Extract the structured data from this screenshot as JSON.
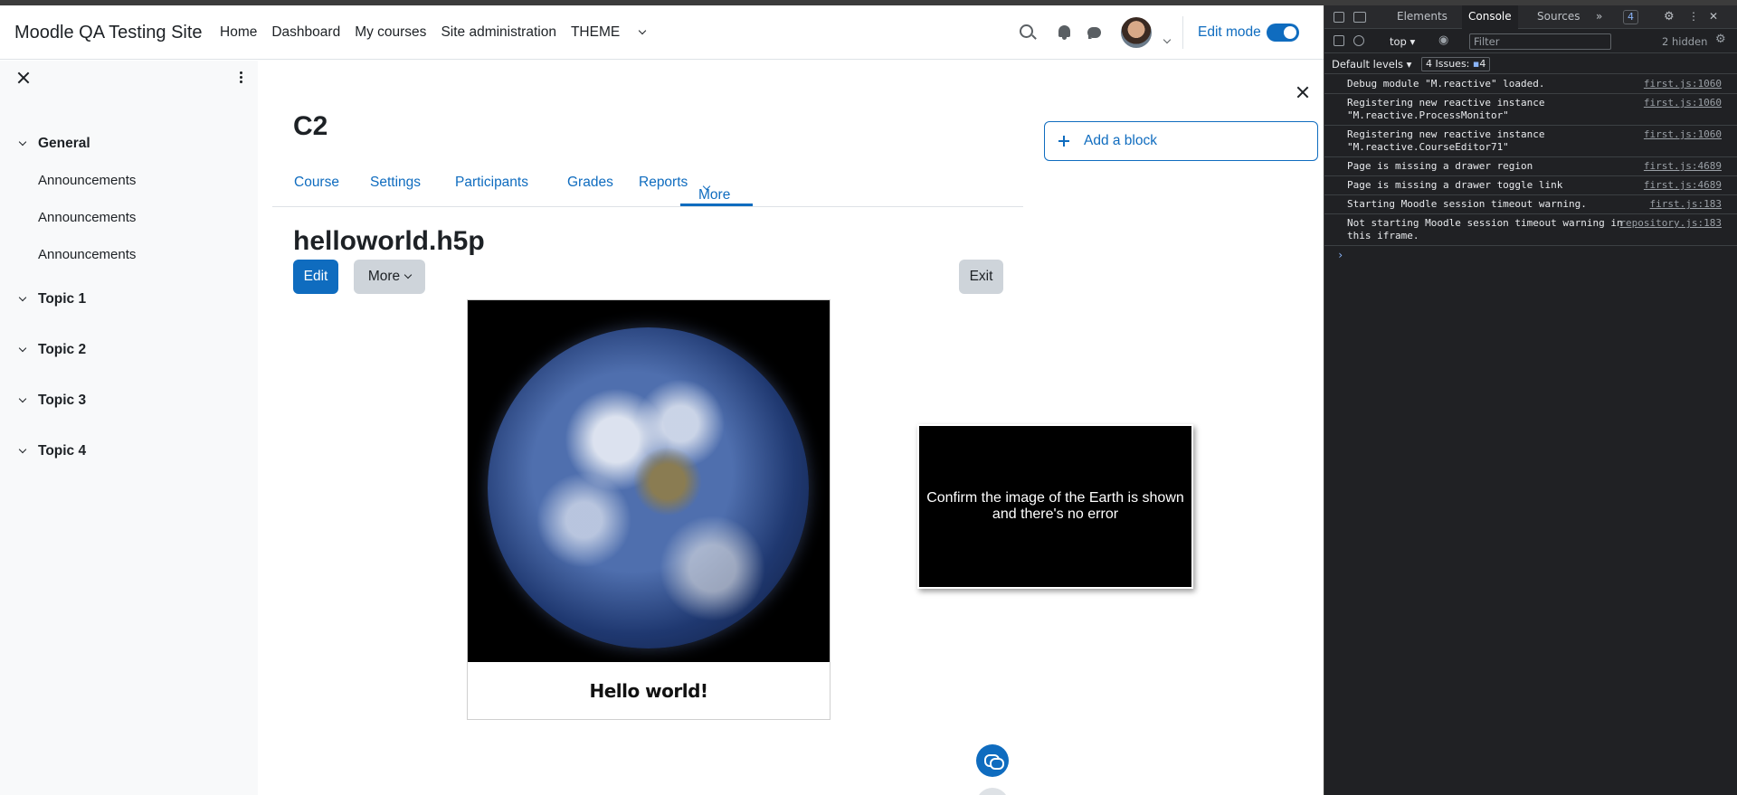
{
  "navbar": {
    "brand": "Moodle QA Testing Site",
    "nav_items": [
      "Home",
      "Dashboard",
      "My courses",
      "Site administration",
      "THEME"
    ],
    "edit_mode_label": "Edit mode"
  },
  "course_index": {
    "sections": [
      {
        "title": "General",
        "items": [
          "Announcements",
          "Announcements",
          "Announcements"
        ]
      },
      {
        "title": "Topic 1"
      },
      {
        "title": "Topic 2"
      },
      {
        "title": "Topic 3"
      },
      {
        "title": "Topic 4"
      }
    ]
  },
  "main": {
    "course_title": "C2",
    "tabs": [
      "Course",
      "Settings",
      "Participants",
      "Grades",
      "Reports",
      "More"
    ],
    "activity_title": "helloworld.h5p",
    "edit_label": "Edit",
    "more_label": "More",
    "exit_label": "Exit",
    "h5p_caption": "Hello world!"
  },
  "blocks": {
    "add_block_label": "Add a block"
  },
  "instruction": {
    "text": "Confirm the image of the Earth is shown and there's no error"
  },
  "devtools": {
    "tabs": [
      "Elements",
      "Console",
      "Sources"
    ],
    "active_tab": "Console",
    "issues_badge": "4",
    "context": "top",
    "filter_placeholder": "Filter",
    "hidden_count": "2 hidden",
    "levels": "Default levels",
    "issues_label": "4 Issues:",
    "issues_count": "4",
    "logs": [
      {
        "msg": "Debug module \"M.reactive\" loaded.",
        "src": "first.js:1060"
      },
      {
        "msg": "Registering new reactive instance \"M.reactive.ProcessMonitor\"",
        "src": "first.js:1060"
      },
      {
        "msg": "Registering new reactive instance \"M.reactive.CourseEditor71\"",
        "src": "first.js:1060"
      },
      {
        "msg": "Page is missing a drawer region",
        "src": "first.js:4689"
      },
      {
        "msg": "Page is missing a drawer toggle link",
        "src": "first.js:4689"
      },
      {
        "msg": "Starting Moodle session timeout warning.",
        "src": "first.js:183"
      },
      {
        "msg": "Not starting Moodle session timeout warning in this iframe.",
        "src": "repository.js:183"
      }
    ],
    "prompt": "›"
  },
  "colors": {
    "primary": "#0f6cbf",
    "drawer_bg": "#f8f9fa",
    "devtools_bg": "#202124"
  }
}
